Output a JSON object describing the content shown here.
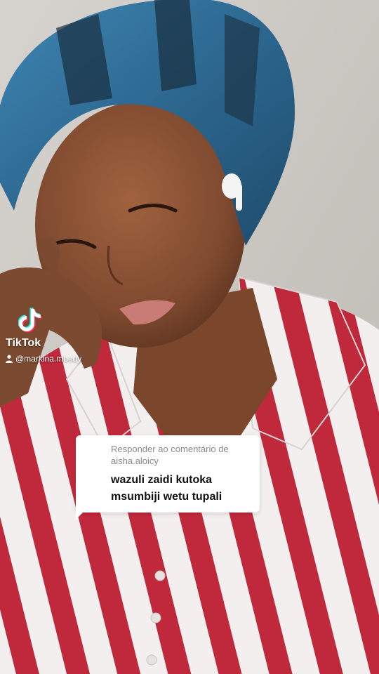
{
  "watermark": {
    "brand": "TikTok",
    "username": "@markina.mbody",
    "icon": "tiktok-note-icon"
  },
  "reply": {
    "header": "Responder ao comentário de aisha.aloicy",
    "comment": "wazuli zaidi kutoka msumbiji wetu tupali",
    "avatar_icon": "user-avatar"
  },
  "colors": {
    "headwrap": "#2f6f98",
    "stripe_red": "#c0293c",
    "stripe_white": "#f2efee",
    "skin": "#8a5236",
    "wall": "#c9c6c1"
  }
}
